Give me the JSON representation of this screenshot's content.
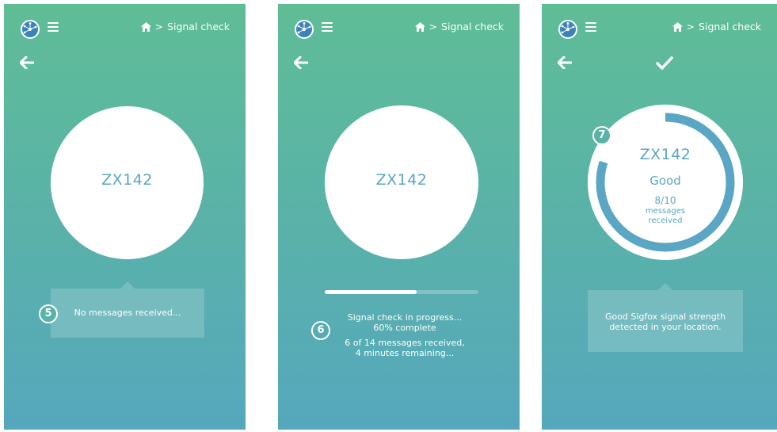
{
  "breadcrumb": {
    "home_icon": "home-icon",
    "separator": ">",
    "label": "Signal check"
  },
  "colors": {
    "gradient_top": "#5fbd96",
    "gradient_bottom": "#55a8bd",
    "accent_blue": "#5aa6c4",
    "logo_blue": "#3c83b8"
  },
  "screen1": {
    "device_id": "ZX142",
    "step": "5",
    "tooltip": "No messages received..."
  },
  "screen2": {
    "device_id": "ZX142",
    "step": "6",
    "progress_percent": 60,
    "status_line1": "Signal check in progress...",
    "status_line2": "60% complete",
    "status_line3": "6 of 14 messages received,",
    "status_line4": "4 minutes remaining..."
  },
  "screen3": {
    "device_id": "ZX142",
    "step": "7",
    "rating": "Good",
    "messages_count": "8/10",
    "messages_label_1": "messages",
    "messages_label_2": "received",
    "ring_fraction": 0.8,
    "tooltip_line1": "Good Sigfox signal strength",
    "tooltip_line2": "detected in your location."
  }
}
